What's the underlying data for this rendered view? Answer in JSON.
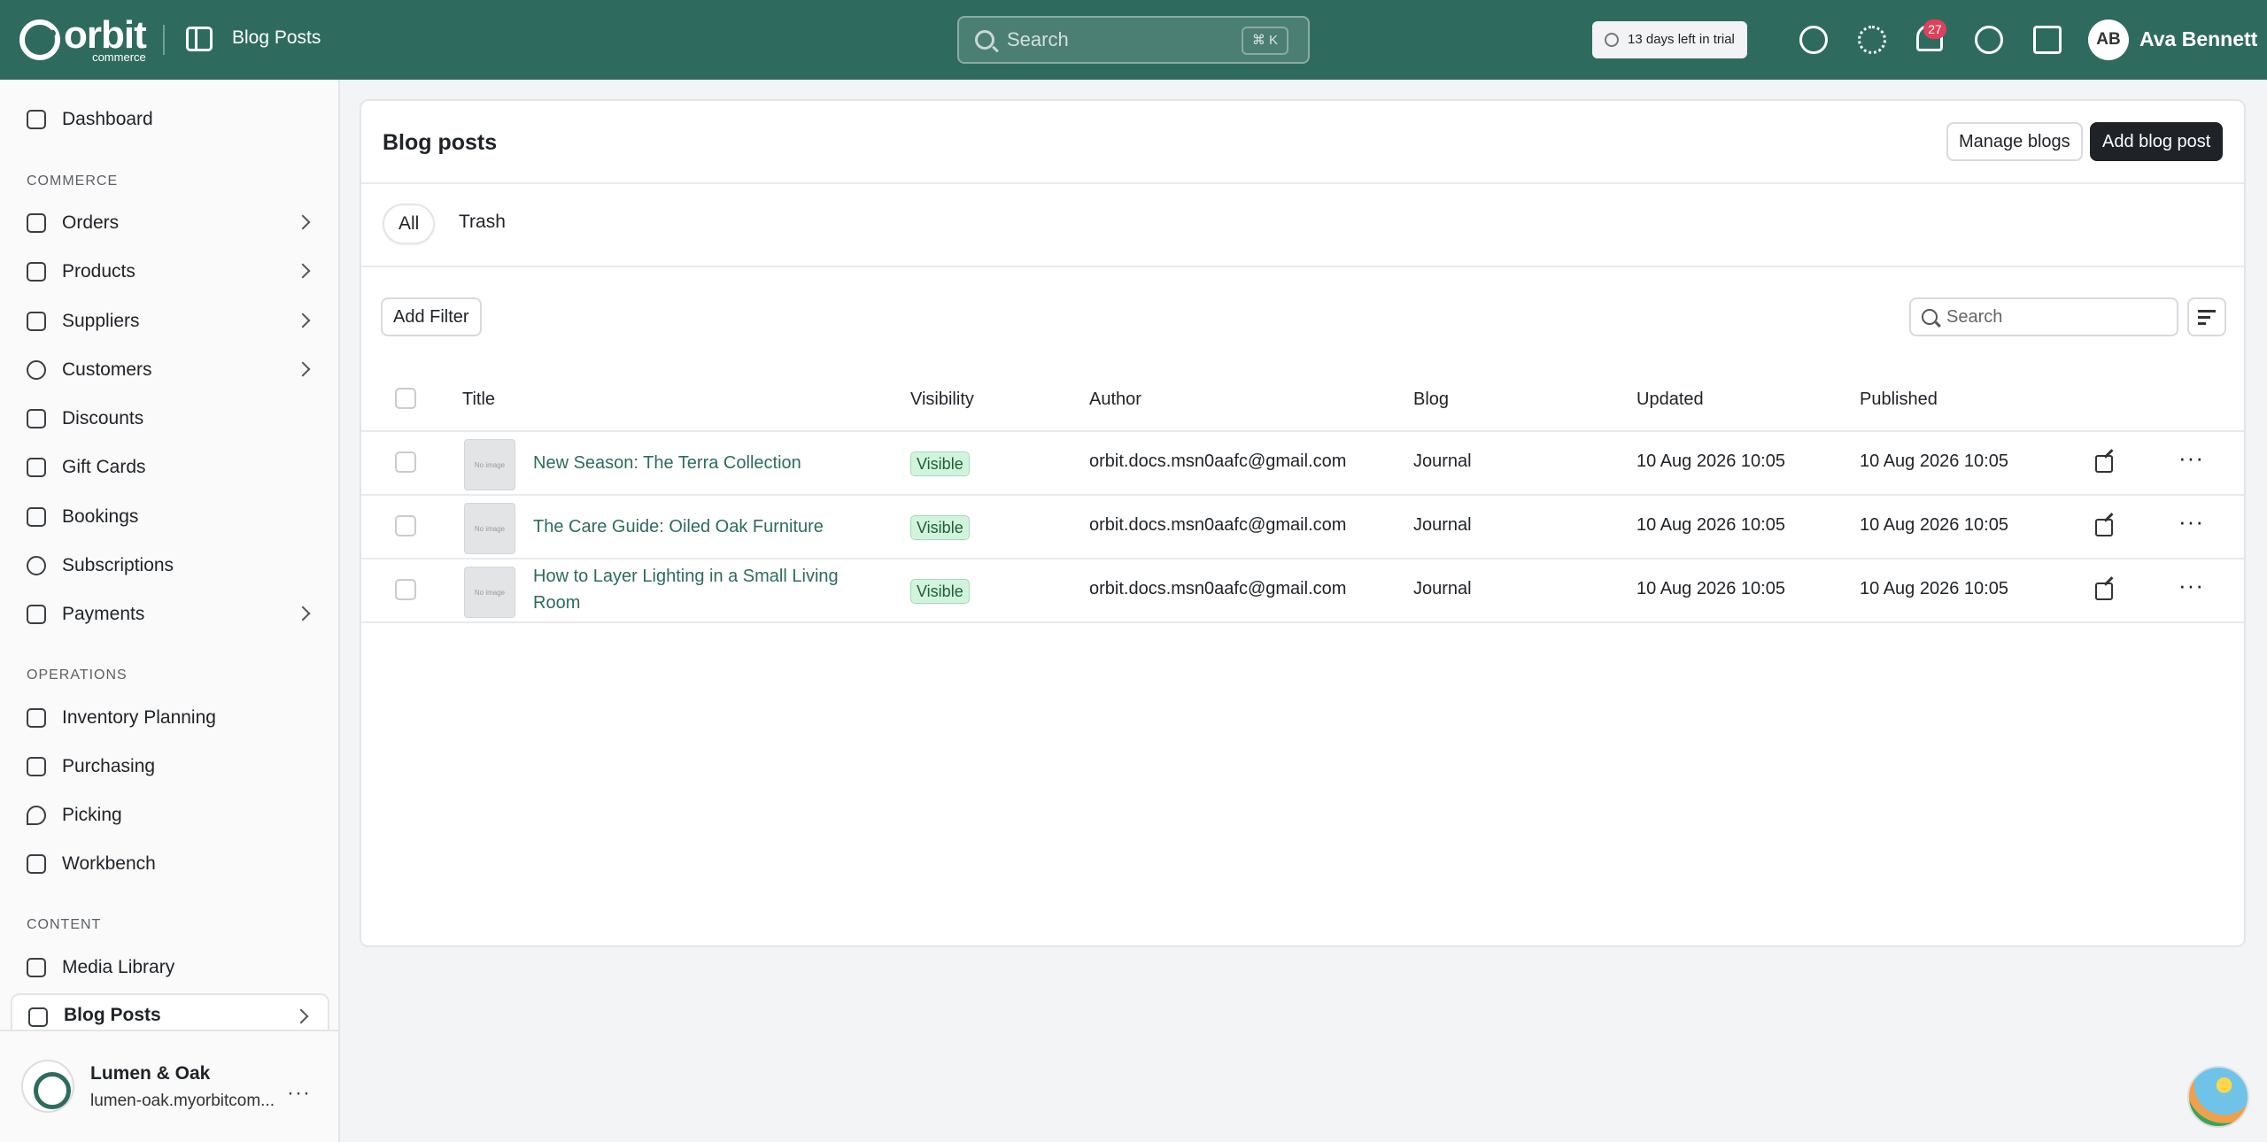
{
  "topbar": {
    "logo_word": "orbit",
    "logo_sub": "commerce",
    "page_title": "Blog Posts",
    "search_placeholder": "Search",
    "search_shortcut": "⌘ K",
    "trial_text": "13 days left in trial",
    "notification_count": "27",
    "user_initials": "AB",
    "user_name": "Ava Bennett"
  },
  "sidebar": {
    "dashboard": "Dashboard",
    "commerce_label": "COMMERCE",
    "commerce": [
      "Orders",
      "Products",
      "Suppliers",
      "Customers",
      "Discounts",
      "Gift Cards",
      "Bookings",
      "Subscriptions",
      "Payments"
    ],
    "operations_label": "OPERATIONS",
    "operations": [
      "Inventory Planning",
      "Purchasing",
      "Picking",
      "Workbench"
    ],
    "content_label": "CONTENT",
    "content": [
      "Media Library",
      "Blog Posts"
    ],
    "store_name": "Lumen & Oak",
    "store_url": "lumen-oak.myorbitcom..."
  },
  "main": {
    "title": "Blog posts",
    "manage_blogs": "Manage blogs",
    "add_blog_post": "Add blog post",
    "tabs": [
      "All",
      "Trash"
    ],
    "add_filter": "Add Filter",
    "search_placeholder": "Search",
    "columns": [
      "Title",
      "Visibility",
      "Author",
      "Blog",
      "Updated",
      "Published"
    ],
    "thumb_text": "No image",
    "rows": [
      {
        "title": "New Season: The Terra Collection",
        "visibility": "Visible",
        "author": "orbit.docs.msn0aafc@gmail.com",
        "blog": "Journal",
        "updated": "10 Aug 2026 10:05",
        "published": "10 Aug 2026 10:05"
      },
      {
        "title": "The Care Guide: Oiled Oak Furniture",
        "visibility": "Visible",
        "author": "orbit.docs.msn0aafc@gmail.com",
        "blog": "Journal",
        "updated": "10 Aug 2026 10:05",
        "published": "10 Aug 2026 10:05"
      },
      {
        "title": "How to Layer Lighting in a Small Living Room",
        "visibility": "Visible",
        "author": "orbit.docs.msn0aafc@gmail.com",
        "blog": "Journal",
        "updated": "10 Aug 2026 10:05",
        "published": "10 Aug 2026 10:05"
      }
    ]
  },
  "colors": {
    "brand": "#2e6b5e",
    "visible_badge_bg": "#d2f4dd",
    "notification_badge": "#e0405b"
  }
}
